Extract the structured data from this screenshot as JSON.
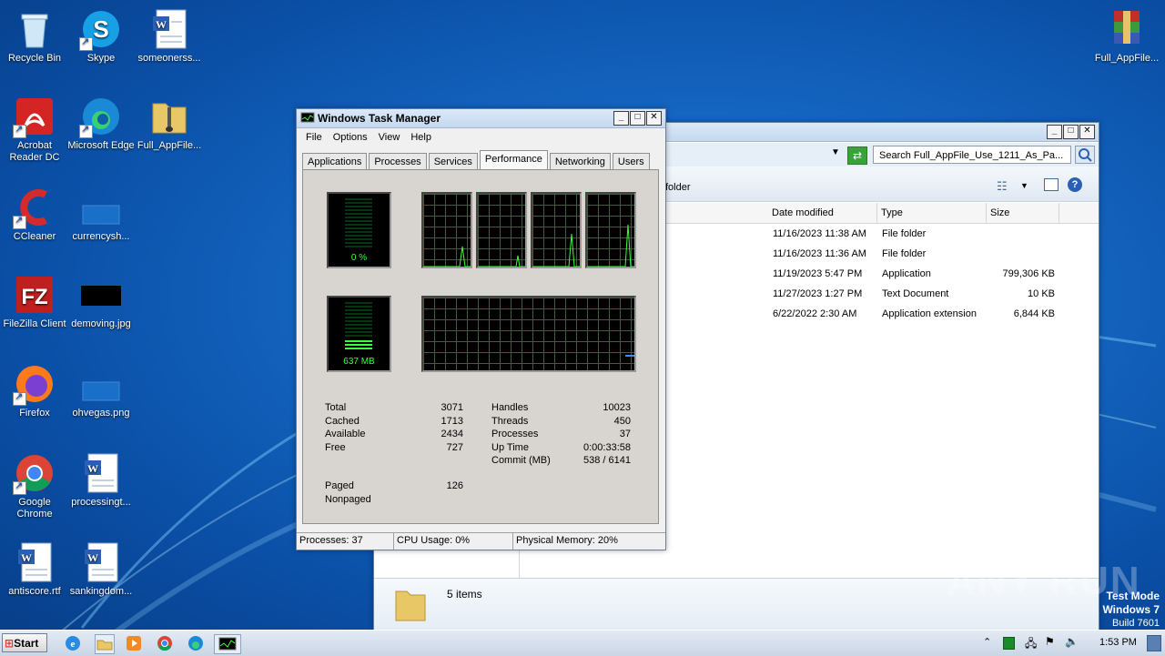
{
  "desktop_icons": [
    {
      "label": "Recycle Bin"
    },
    {
      "label": "Skype"
    },
    {
      "label": "someonerss..."
    },
    {
      "label": "Full_AppFile..."
    },
    {
      "label": "Acrobat Reader DC"
    },
    {
      "label": "Microsoft Edge"
    },
    {
      "label": "Full_AppFile..."
    },
    {
      "label": "CCleaner"
    },
    {
      "label": "currencysh..."
    },
    {
      "label": "FileZilla Client"
    },
    {
      "label": "demoving.jpg"
    },
    {
      "label": "Firefox"
    },
    {
      "label": "ohvegas.png"
    },
    {
      "label": "Google Chrome"
    },
    {
      "label": "processingt..."
    },
    {
      "label": "antiscore.rtf"
    },
    {
      "label": "sankingdom..."
    }
  ],
  "explorer": {
    "search_placeholder": "Search Full_AppFile_Use_1211_As_Pa...",
    "toolbar_text": "folder",
    "columns": [
      "Date modified",
      "Type",
      "Size"
    ],
    "rows": [
      {
        "date": "11/16/2023 11:38 AM",
        "type": "File folder",
        "size": ""
      },
      {
        "date": "11/16/2023 11:36 AM",
        "type": "File folder",
        "size": ""
      },
      {
        "date": "11/19/2023 5:47 PM",
        "type": "Application",
        "size": "799,306 KB"
      },
      {
        "date": "11/27/2023 1:27 PM",
        "type": "Text Document",
        "size": "10 KB"
      },
      {
        "date": "6/22/2022 2:30 AM",
        "type": "Application extension",
        "size": "6,844 KB"
      }
    ],
    "item_count": "5 items"
  },
  "taskmgr": {
    "title": "Windows Task Manager",
    "menu": [
      "File",
      "Options",
      "View",
      "Help"
    ],
    "tabs": [
      "Applications",
      "Processes",
      "Services",
      "Performance",
      "Networking",
      "Users"
    ],
    "active_tab": "Performance",
    "cpu_meter": "0 %",
    "mem_meter": "637 MB",
    "physical_memory": {
      "rows": [
        {
          "label": "Total",
          "value": "3071"
        },
        {
          "label": "Cached",
          "value": "1713"
        },
        {
          "label": "Available",
          "value": "2434"
        },
        {
          "label": "Free",
          "value": "727"
        }
      ]
    },
    "system": {
      "rows": [
        {
          "label": "Handles",
          "value": "10023"
        },
        {
          "label": "Threads",
          "value": "450"
        },
        {
          "label": "Processes",
          "value": "37"
        },
        {
          "label": "Up Time",
          "value": "0:00:33:58"
        },
        {
          "label": "Commit (MB)",
          "value": "538 / 6141"
        }
      ]
    },
    "kernel": {
      "rows": [
        {
          "label": "Paged",
          "value": "126"
        },
        {
          "label": "Nonpaged",
          "value": ""
        }
      ]
    },
    "status": {
      "processes": "Processes: 37",
      "cpu": "CPU Usage: 0%",
      "memory": "Physical Memory: 20%"
    }
  },
  "watermark": {
    "brand": "ANY RUN",
    "line1": "Test Mode",
    "line2": "Windows 7",
    "line3": "Build 7601"
  },
  "taskbar": {
    "start_label": "Start",
    "clock": "1:53 PM"
  }
}
